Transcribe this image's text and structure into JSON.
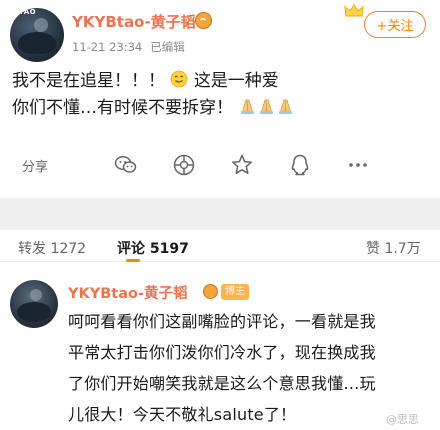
{
  "post": {
    "author": "YKYBtao-黄子韬",
    "avatar_tag": "TAO",
    "time": "11-21 23:34",
    "edited": "已编辑",
    "follow_label": "+关注",
    "text_line1": "我不是在追星！！！",
    "text_line1b": "这是一种爱",
    "text_line2": "你们不懂…有时候不要拆穿！",
    "share_label": "分享"
  },
  "icons": [
    "vip-badge-icon",
    "crown-icon",
    "smile-emoji-icon",
    "pray-emoji-icon",
    "wechat-icon",
    "moments-icon",
    "qzone-icon",
    "star-icon",
    "more-icon"
  ],
  "tabs": {
    "repost": "转发 1272",
    "comment": "评论 5197",
    "like": "赞 1.7万"
  },
  "comment": {
    "author": "YKYBtao-黄子韬",
    "badge": "博主",
    "text_line1": "呵呵看看你们这副嘴脸的评论，一看就是我",
    "text_line2": "平常太打击你们泼你们冷水了，现在换成我",
    "text_line3": "了你们开始嘲笑我就是这么个意思我懂…玩",
    "text_line4": "儿很大！今天不敬礼salute了！"
  },
  "watermark": "@思思",
  "colors": {
    "username": "#eb7350",
    "accent": "#ff8200",
    "muted": "#8a8a8a",
    "divider": "#f0f0f0"
  }
}
